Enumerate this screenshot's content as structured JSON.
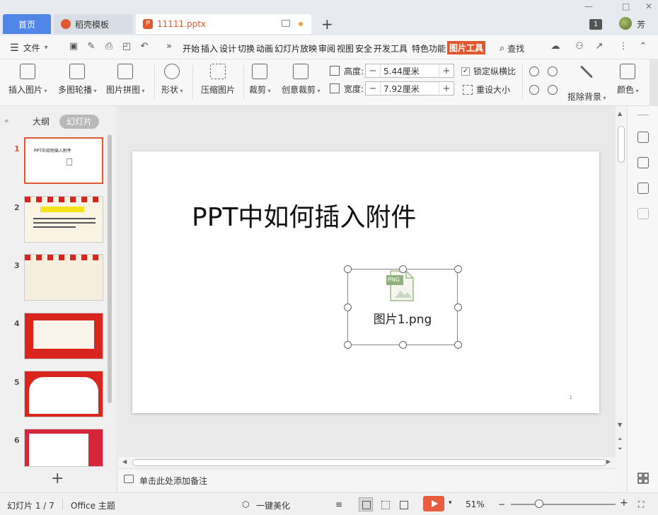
{
  "tabs": {
    "home": "首页",
    "template": "稻壳模板",
    "document": "11111.pptx",
    "add": "+"
  },
  "window": {
    "minimize": "—",
    "maximize": "□",
    "close": "✕",
    "badge": "1",
    "user": "芳"
  },
  "menu": {
    "file": "文件",
    "file_arrow": "▾",
    "more": "»",
    "items": [
      "开始",
      "插入",
      "设计",
      "切换",
      "动画",
      "幻灯片放映",
      "审阅",
      "视图",
      "安全",
      "开发工具",
      "特色功能",
      "图片工具"
    ],
    "active_index": 11,
    "search": "查找"
  },
  "ribbon": {
    "insert_image": "插入图片",
    "multi_carousel": "多图轮播",
    "image_collage": "图片拼图",
    "shape": "形状",
    "compress": "压缩图片",
    "crop": "裁剪",
    "creative_crop": "创意裁剪",
    "height_label": "高度:",
    "height_value": "5.44厘米",
    "width_label": "宽度:",
    "width_value": "7.92厘米",
    "minus": "−",
    "plus": "+",
    "lock_ratio": "锁定纵横比",
    "reset_size": "重设大小",
    "remove_bg": "抠除背景",
    "color": "颜色"
  },
  "panel": {
    "collapse": "«",
    "outline_tab": "大纲",
    "slides_tab": "幻灯片",
    "thumbs": [
      {
        "num": "1",
        "title": "PPT中如何插入附件"
      },
      {
        "num": "2"
      },
      {
        "num": "3"
      },
      {
        "num": "4"
      },
      {
        "num": "5"
      },
      {
        "num": "6"
      }
    ],
    "active_slide": 1,
    "add": "+"
  },
  "slide": {
    "title": "PPT中如何插入附件",
    "attachment_label": "图片1.png",
    "attachment_type": "PNG",
    "page_number": "1"
  },
  "notes": {
    "placeholder": "单击此处添加备注"
  },
  "statusbar": {
    "slide_indicator": "幻灯片 1 / 7",
    "theme": "Office 主题",
    "beautify": "一键美化",
    "zoom": "51%",
    "zoom_level": 0.51,
    "minus": "−",
    "plus": "+"
  },
  "colors": {
    "accent": "#e0582e",
    "home_tab": "#4f86e8",
    "play": "#e95c3d"
  }
}
